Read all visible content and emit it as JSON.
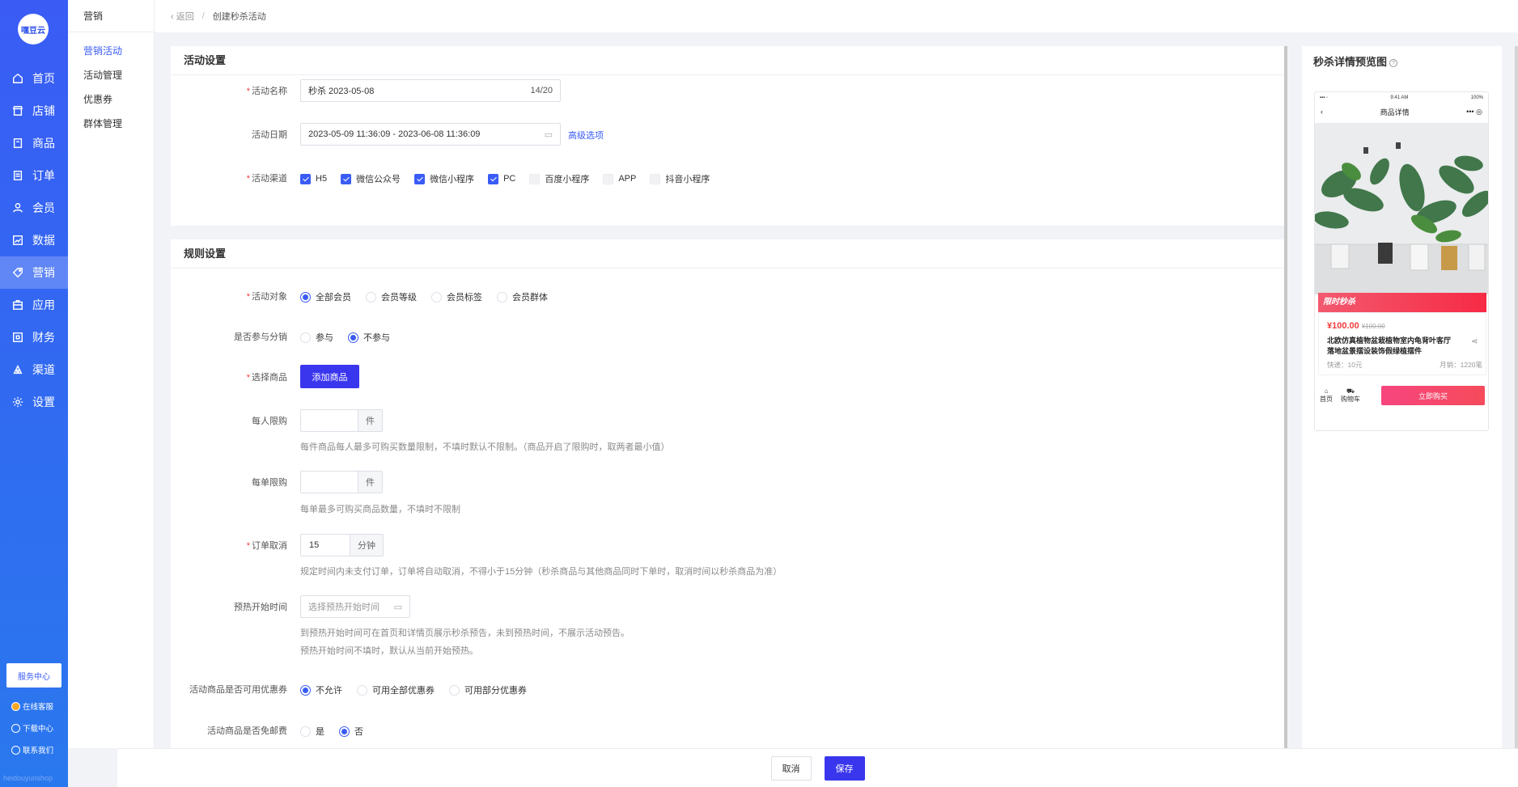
{
  "app": {
    "logo_text": "嘿豆云",
    "footer_watermark": "heidouyunshop"
  },
  "rail": {
    "items": [
      {
        "label": "首页",
        "icon": "home-icon"
      },
      {
        "label": "店铺",
        "icon": "store-icon"
      },
      {
        "label": "商品",
        "icon": "goods-icon"
      },
      {
        "label": "订单",
        "icon": "order-icon"
      },
      {
        "label": "会员",
        "icon": "member-icon"
      },
      {
        "label": "数据",
        "icon": "chart-icon"
      },
      {
        "label": "营销",
        "icon": "tag-icon"
      },
      {
        "label": "应用",
        "icon": "app-icon"
      },
      {
        "label": "财务",
        "icon": "finance-icon"
      },
      {
        "label": "渠道",
        "icon": "channel-icon"
      },
      {
        "label": "设置",
        "icon": "gear-icon"
      }
    ],
    "service_center": "服务中心",
    "online_service": "在线客服",
    "download_center": "下载中心",
    "contact_us": "联系我们"
  },
  "sub": {
    "title": "营销",
    "items": [
      "营销活动",
      "活动管理",
      "优惠券",
      "群体管理"
    ]
  },
  "breadcrumb": {
    "back": "返回",
    "current": "创建秒杀活动"
  },
  "activity": {
    "section_title": "活动设置",
    "name_label": "活动名称",
    "name_value": "秒杀  2023-05-08",
    "name_count": "14/20",
    "date_label": "活动日期",
    "date_value": "2023-05-09 11:36:09 - 2023-06-08 11:36:09",
    "advanced_link": "高级选项",
    "channel_label": "活动渠道",
    "channels": [
      {
        "label": "H5",
        "checked": true
      },
      {
        "label": "微信公众号",
        "checked": true
      },
      {
        "label": "微信小程序",
        "checked": true
      },
      {
        "label": "PC",
        "checked": true
      },
      {
        "label": "百度小程序",
        "checked": false
      },
      {
        "label": "APP",
        "checked": false
      },
      {
        "label": "抖音小程序",
        "checked": false
      }
    ]
  },
  "rules": {
    "section_title": "规则设置",
    "target_label": "活动对象",
    "targets": [
      "全部会员",
      "会员等级",
      "会员标签",
      "会员群体"
    ],
    "distribution_label": "是否参与分销",
    "distribution": [
      "参与",
      "不参与"
    ],
    "goods_label": "选择商品",
    "add_goods": "添加商品",
    "per_person_label": "每人限购",
    "per_person_suffix": "件",
    "per_person_help": "每件商品每人最多可购买数量限制，不填时默认不限制。（商品开启了限购时，取两者最小值）",
    "per_order_label": "每单限购",
    "per_order_suffix": "件",
    "per_order_help": "每单最多可购买商品数量，不填时不限制",
    "cancel_label": "订单取消",
    "cancel_value": "15",
    "cancel_suffix": "分钟",
    "cancel_help": "规定时间内未支付订单，订单将自动取消，不得小于15分钟（秒杀商品与其他商品同时下单时，取消时间以秒杀商品为准）",
    "preheat_label": "预热开始时间",
    "preheat_placeholder": "选择预热开始时间",
    "preheat_help1": "到预热开始时间可在首页和详情页展示秒杀预告，未到预热时间，不展示活动预告。",
    "preheat_help2": "预热开始时间不填时，默认从当前开始预热。",
    "coupon_label": "活动商品是否可用优惠券",
    "coupons": [
      "不允许",
      "可用全部优惠券",
      "可用部分优惠券"
    ],
    "freeship_label": "活动商品是否免邮费",
    "freeship": [
      "是",
      "否"
    ]
  },
  "preview": {
    "title": "秒杀详情预览图",
    "status_time": "9:41 AM",
    "status_battery": "100%",
    "page_title": "商品详情",
    "flash_label": "限时秒杀",
    "price": "¥100.00",
    "orig_price": "¥100.00",
    "product_name": "北欧仿真植物盆栽植物室内龟背叶客厅落地盆景摆设装饰假绿植摆件",
    "shipping": "快递：10元",
    "monthly_sales": "月销：1220笔",
    "tab_home": "首页",
    "tab_cart": "购物车",
    "buy_now": "立即购买"
  },
  "footer": {
    "cancel": "取消",
    "save": "保存"
  },
  "colors": {
    "primary": "#3a36ee",
    "rail": "#3a5cf5",
    "required": "#f23b3b"
  }
}
